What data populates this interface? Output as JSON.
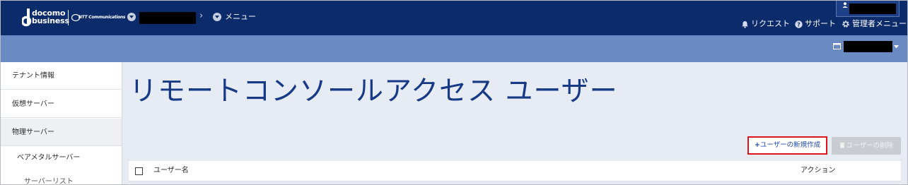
{
  "header": {
    "brand_line1": "docomo",
    "brand_line2": "business",
    "partner_logo_text": "NTT Communications",
    "breadcrumb_menu": "メニュー",
    "nav": [
      {
        "label": "リクエスト",
        "icon": "bell-icon"
      },
      {
        "label": "サポート",
        "icon": "help-circle-icon"
      },
      {
        "label": "管理者メニュー",
        "icon": "gear-icon"
      }
    ]
  },
  "sidebar": {
    "items": [
      {
        "label": "テナント情報"
      },
      {
        "label": "仮想サーバー"
      },
      {
        "label": "物理サーバー"
      }
    ],
    "sub_item": "ベアメタルサーバー",
    "sub_sub_item": "サーバーリスト"
  },
  "main": {
    "title": "リモートコンソールアクセス ユーザー",
    "new_user_button": "ユーザーの新規作成",
    "delete_user_button": "ユーザーの削除",
    "table": {
      "columns": [
        "ユーザー名",
        "アクション"
      ]
    }
  },
  "colors": {
    "header_bg": "#0c2b6b",
    "subbar_bg": "#6a8ac4",
    "main_bg": "#e7ebf3",
    "title_color": "#173a86",
    "highlight_border": "#e0121b"
  }
}
